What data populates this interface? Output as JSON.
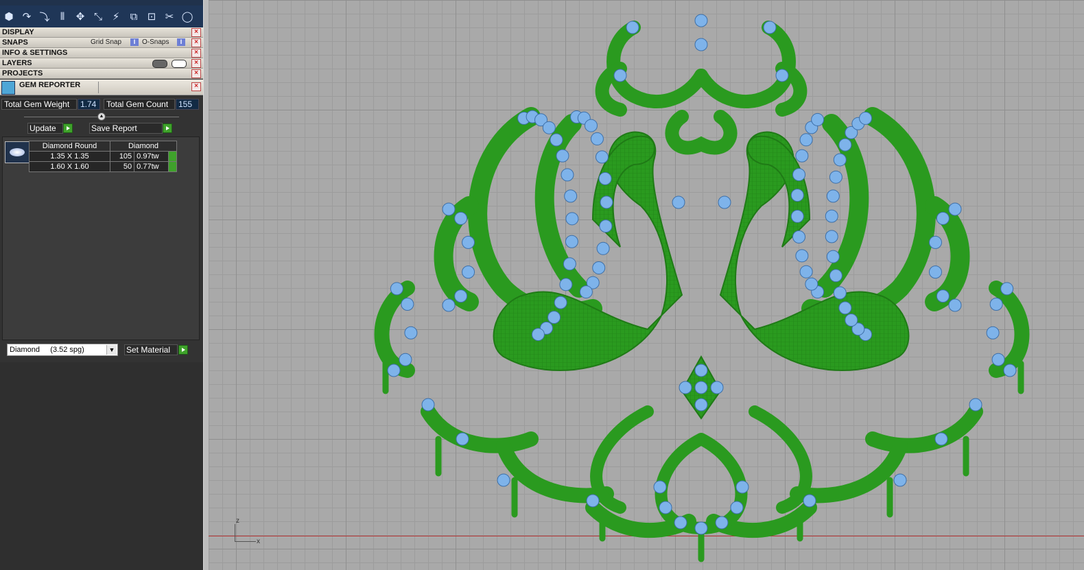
{
  "toolbar": {
    "tools": [
      "select-icon",
      "curve-icon",
      "bend-icon",
      "mirror-icon",
      "move-icon",
      "scale-icon",
      "deform-icon",
      "group-icon",
      "ungroup-icon",
      "trim-icon",
      "circle-icon"
    ]
  },
  "panels": {
    "display": "DISPLAY",
    "snaps": "SNAPS",
    "grid_snap": "Grid Snap",
    "o_snaps": "O-Snaps",
    "info": "INFO & SETTINGS",
    "layers": "LAYERS",
    "projects": "PROJECTS",
    "gem_reporter": "GEM REPORTER"
  },
  "summary": {
    "weight_label": "Total Gem Weight",
    "weight_value": "1.74",
    "count_label": "Total Gem Count",
    "count_value": "155"
  },
  "buttons": {
    "update": "Update",
    "save_report": "Save Report",
    "set_material": "Set Material"
  },
  "gem_table": {
    "headers": [
      "Diamond Round",
      "Diamond"
    ],
    "rows": [
      {
        "size": "1.35 X 1.35",
        "count": "105",
        "weight": "0.97tw"
      },
      {
        "size": "1.60 X 1.60",
        "count": "50",
        "weight": "0.77tw"
      }
    ]
  },
  "material": {
    "selected": "Diamond     (3.52 spg)"
  },
  "viewport": {
    "axis_z": "z",
    "axis_x": "x"
  },
  "colors": {
    "metal": "#2a9a1f",
    "gem": "#7eb3ea",
    "grid": "#a9a9a9",
    "axis": "#b53333"
  }
}
